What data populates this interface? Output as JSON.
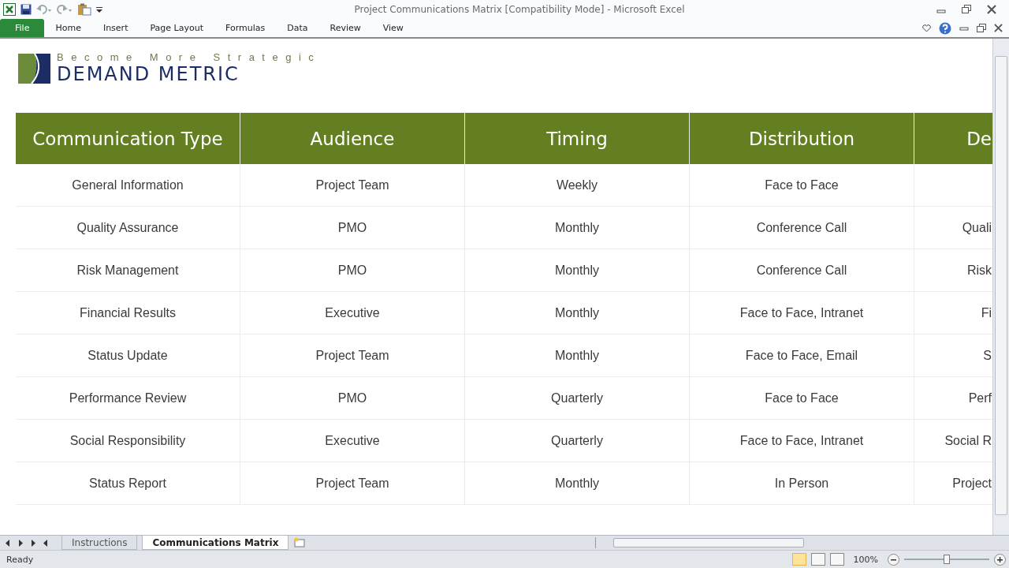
{
  "window": {
    "title": "Project Communications Matrix  [Compatibility Mode]  -  Microsoft Excel"
  },
  "ribbon_tabs": [
    {
      "label": "File",
      "kind": "file"
    },
    {
      "label": "Home",
      "kind": "tab"
    },
    {
      "label": "Insert",
      "kind": "tab"
    },
    {
      "label": "Page Layout",
      "kind": "tab"
    },
    {
      "label": "Formulas",
      "kind": "tab"
    },
    {
      "label": "Data",
      "kind": "tab"
    },
    {
      "label": "Review",
      "kind": "tab"
    },
    {
      "label": "View",
      "kind": "tab"
    }
  ],
  "logo": {
    "tagline": "Become More Strategic",
    "name": "DEMAND METRIC"
  },
  "table": {
    "columns": [
      "Communication Type",
      "Audience",
      "Timing",
      "Distribution",
      "De"
    ],
    "rows": [
      [
        "General Information",
        "Project Team",
        "Weekly",
        "Face to Face",
        ""
      ],
      [
        "Quality Assurance",
        "PMO",
        "Monthly",
        "Conference Call",
        "Quali"
      ],
      [
        "Risk Management",
        "PMO",
        "Monthly",
        "Conference Call",
        "Risk"
      ],
      [
        "Financial Results",
        "Executive",
        "Monthly",
        "Face to Face, Intranet",
        "Fi"
      ],
      [
        "Status Update",
        "Project Team",
        "Monthly",
        "Face to Face, Email",
        "S"
      ],
      [
        "Performance Review",
        "PMO",
        "Quarterly",
        "Face to Face",
        "Perf"
      ],
      [
        "Social Responsibility",
        "Executive",
        "Quarterly",
        "Face to Face, Intranet",
        "Social R"
      ],
      [
        "Status Report",
        "Project Team",
        "Monthly",
        "In Person",
        "Project"
      ]
    ]
  },
  "sheet_tabs": [
    {
      "label": "Instructions",
      "selected": false
    },
    {
      "label": "Communications Matrix",
      "selected": true
    }
  ],
  "status_bar": {
    "status": "Ready",
    "views": [
      {
        "selected": true
      },
      {
        "selected": false
      },
      {
        "selected": false
      }
    ],
    "zoom": "100%",
    "zoom_slider": {
      "level": 0.5
    }
  }
}
